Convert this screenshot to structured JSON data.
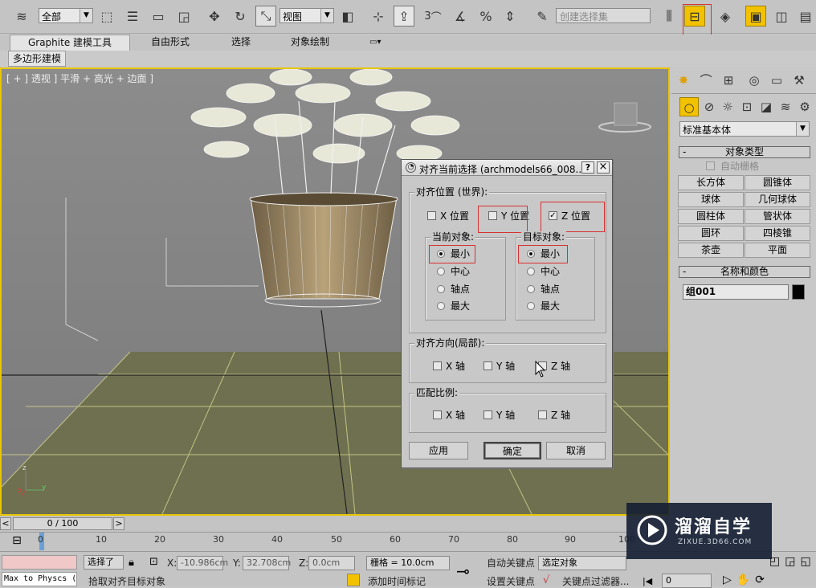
{
  "toolbar": {
    "selection_filter": "全部",
    "ref_coord": "视图",
    "snap_angle": "3",
    "selection_set_placeholder": "创建选择集"
  },
  "ribbon": {
    "tabs": [
      "Graphite 建模工具",
      "自由形式",
      "选择",
      "对象绘制"
    ],
    "sub_tab": "多边形建模"
  },
  "viewport": {
    "label": "[ + ] 透视 ] 平滑 + 高光 + 边面 ]",
    "axis_x": "x",
    "axis_y": "y",
    "axis_z": "z"
  },
  "dialog": {
    "title": "对齐当前选择 (archmodels66_008...",
    "help": "?",
    "close": "×",
    "align_position_label": "对齐位置 (世界):",
    "x_pos": "X 位置",
    "y_pos": "Y 位置",
    "z_pos": "Z 位置",
    "x_checked": false,
    "y_checked": false,
    "z_checked": true,
    "current_object_label": "当前对象:",
    "target_object_label": "目标对象:",
    "options": [
      "最小",
      "中心",
      "轴点",
      "最大"
    ],
    "current_selected": "最小",
    "target_selected": "最小",
    "align_orient_label": "对齐方向(局部):",
    "match_scale_label": "匹配比例:",
    "x_axis": "X 轴",
    "y_axis": "Y 轴",
    "z_axis": "Z 轴",
    "apply": "应用",
    "ok": "确定",
    "cancel": "取消"
  },
  "panel": {
    "category_dropdown": "标准基本体",
    "object_type_header": "对象类型",
    "autogrid": "自动栅格",
    "buttons": [
      "长方体",
      "圆锥体",
      "球体",
      "几何球体",
      "圆柱体",
      "管状体",
      "圆环",
      "四棱锥",
      "茶壶",
      "平面"
    ],
    "name_color_header": "名称和颜色",
    "object_name": "组001",
    "object_color": "#000000"
  },
  "timeline": {
    "frame": "0 / 100",
    "prev": "<",
    "next": ">",
    "ticks": [
      "0",
      "10",
      "20",
      "30",
      "40",
      "50",
      "60",
      "70",
      "80",
      "90",
      "100"
    ]
  },
  "status": {
    "script_listener": "Max to Physcs (",
    "selected": "选择了",
    "x_label": "X:",
    "x_value": "-10.986cm",
    "y_label": "Y:",
    "y_value": "32.708cm",
    "z_label": "Z:",
    "z_value": "0.0cm",
    "grid": "栅格 = 10.0cm",
    "prompt": "拾取对齐目标对象",
    "add_time_tag": "添加时间标记",
    "auto_key": "自动关键点",
    "set_key": "设置关键点",
    "key_mode": "选定对象",
    "key_filters": "关键点过滤器...",
    "current_frame": "0"
  },
  "watermark": {
    "brand": "溜溜自学",
    "url": "ZIXUE.3D66.COM"
  },
  "colors": {
    "viewport_border": "#e8c500",
    "highlight": "#d83030",
    "active_tool": "#f2c200"
  }
}
